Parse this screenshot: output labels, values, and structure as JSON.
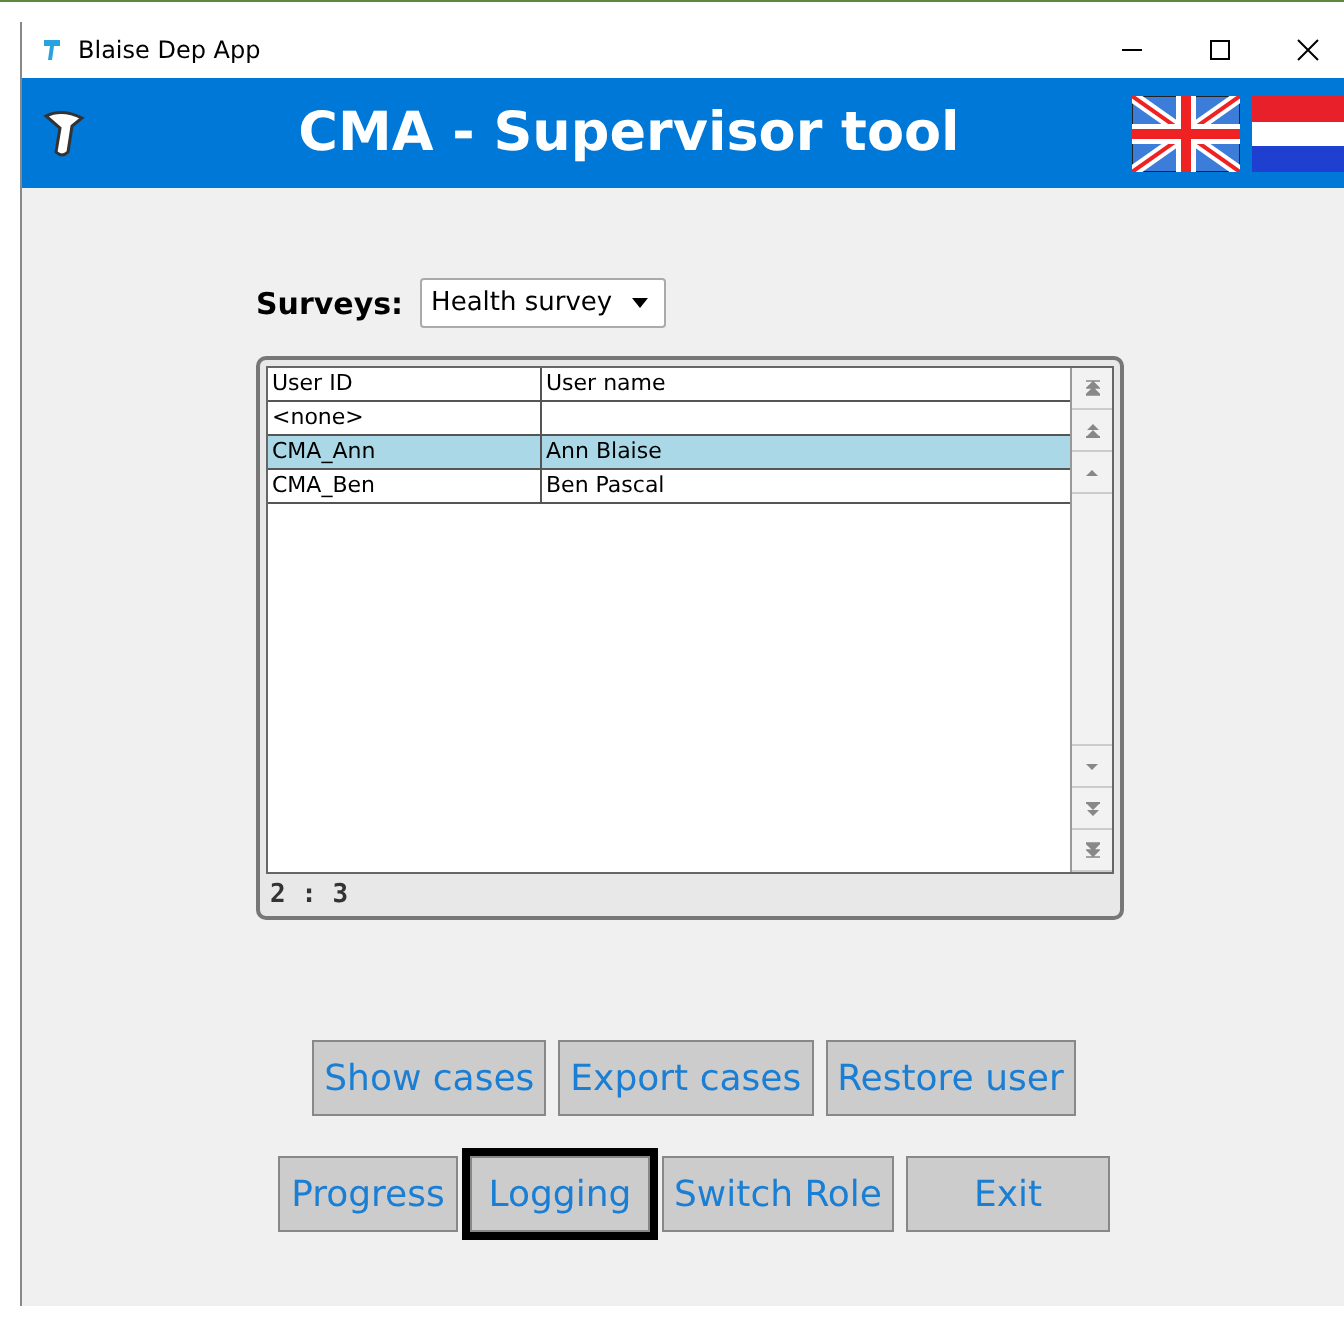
{
  "window": {
    "title": "Blaise Dep App"
  },
  "header": {
    "title": "CMA - Supervisor tool"
  },
  "surveys": {
    "label": "Surveys:",
    "value": "Health survey"
  },
  "table": {
    "columns": [
      "User ID",
      "User name"
    ],
    "rows": [
      {
        "cells": [
          "<none>",
          ""
        ],
        "selected": false
      },
      {
        "cells": [
          "CMA_Ann",
          "Ann Blaise"
        ],
        "selected": true
      },
      {
        "cells": [
          "CMA_Ben",
          "Ben Pascal"
        ],
        "selected": false
      }
    ],
    "footer": "2 : 3"
  },
  "button_rows": [
    [
      {
        "label": "Show cases",
        "focused": false
      },
      {
        "label": "Export cases",
        "focused": false
      },
      {
        "label": "Restore user",
        "focused": false
      }
    ],
    [
      {
        "label": "Progress",
        "focused": false
      },
      {
        "label": "Logging",
        "focused": true
      },
      {
        "label": "Switch Role",
        "focused": false
      },
      {
        "label": "Exit",
        "focused": false
      }
    ]
  ]
}
